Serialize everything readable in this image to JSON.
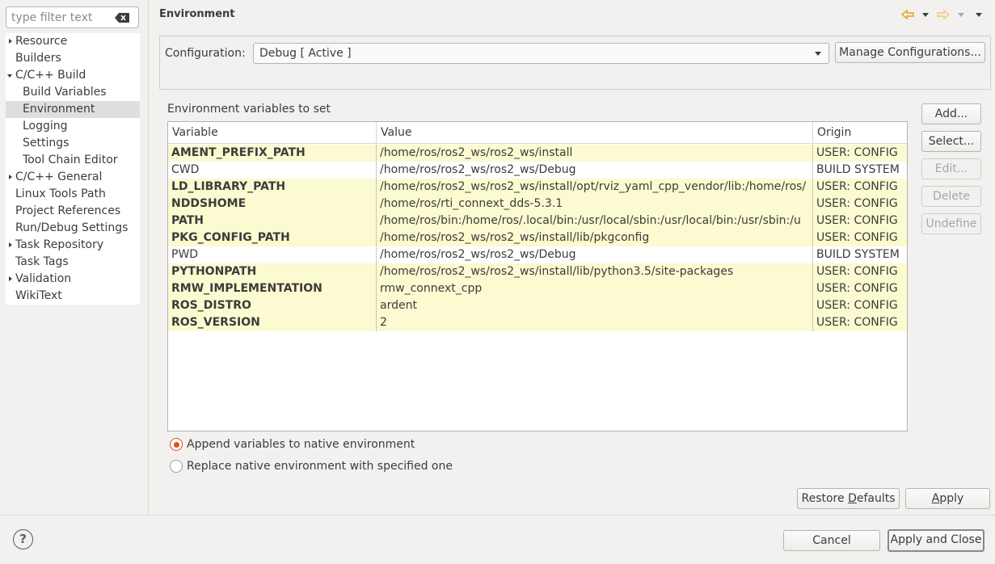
{
  "filter": {
    "placeholder": "type filter text"
  },
  "tree": [
    {
      "label": "Resource",
      "expander": "right",
      "indent": 0
    },
    {
      "label": "Builders",
      "expander": "none",
      "indent": 0
    },
    {
      "label": "C/C++ Build",
      "expander": "down",
      "indent": 0
    },
    {
      "label": "Build Variables",
      "expander": "none",
      "indent": 1
    },
    {
      "label": "Environment",
      "expander": "none",
      "indent": 1,
      "selected": true
    },
    {
      "label": "Logging",
      "expander": "none",
      "indent": 1
    },
    {
      "label": "Settings",
      "expander": "none",
      "indent": 1
    },
    {
      "label": "Tool Chain Editor",
      "expander": "none",
      "indent": 1
    },
    {
      "label": "C/C++ General",
      "expander": "right",
      "indent": 0
    },
    {
      "label": "Linux Tools Path",
      "expander": "none",
      "indent": 0
    },
    {
      "label": "Project References",
      "expander": "none",
      "indent": 0
    },
    {
      "label": "Run/Debug Settings",
      "expander": "none",
      "indent": 0
    },
    {
      "label": "Task Repository",
      "expander": "right",
      "indent": 0
    },
    {
      "label": "Task Tags",
      "expander": "none",
      "indent": 0
    },
    {
      "label": "Validation",
      "expander": "right",
      "indent": 0
    },
    {
      "label": "WikiText",
      "expander": "none",
      "indent": 0
    }
  ],
  "page": {
    "title": "Environment"
  },
  "config": {
    "label": "Configuration:",
    "value": "Debug  [ Active ]",
    "manage_label": "Manage Configurations..."
  },
  "env": {
    "label": "Environment variables to set",
    "columns": [
      "Variable",
      "Value",
      "Origin"
    ],
    "rows": [
      {
        "variable": "AMENT_PREFIX_PATH",
        "value": "/home/ros/ros2_ws/ros2_ws/install",
        "origin": "USER: CONFIG"
      },
      {
        "variable": "CWD",
        "value": "/home/ros/ros2_ws/ros2_ws/Debug",
        "origin": "BUILD SYSTEM"
      },
      {
        "variable": "LD_LIBRARY_PATH",
        "value": "/home/ros/ros2_ws/ros2_ws/install/opt/rviz_yaml_cpp_vendor/lib:/home/ros/",
        "origin": "USER: CONFIG"
      },
      {
        "variable": "NDDSHOME",
        "value": "/home/ros/rti_connext_dds-5.3.1",
        "origin": "USER: CONFIG"
      },
      {
        "variable": "PATH",
        "value": "/home/ros/bin:/home/ros/.local/bin:/usr/local/sbin:/usr/local/bin:/usr/sbin:/u",
        "origin": "USER: CONFIG"
      },
      {
        "variable": "PKG_CONFIG_PATH",
        "value": "/home/ros/ros2_ws/ros2_ws/install/lib/pkgconfig",
        "origin": "USER: CONFIG"
      },
      {
        "variable": "PWD",
        "value": "/home/ros/ros2_ws/ros2_ws/Debug",
        "origin": "BUILD SYSTEM"
      },
      {
        "variable": "PYTHONPATH",
        "value": "/home/ros/ros2_ws/ros2_ws/install/lib/python3.5/site-packages",
        "origin": "USER: CONFIG"
      },
      {
        "variable": "RMW_IMPLEMENTATION",
        "value": "rmw_connext_cpp",
        "origin": "USER: CONFIG"
      },
      {
        "variable": "ROS_DISTRO",
        "value": "ardent",
        "origin": "USER: CONFIG"
      },
      {
        "variable": "ROS_VERSION",
        "value": "2",
        "origin": "USER: CONFIG"
      }
    ]
  },
  "side_buttons": {
    "add": "Add...",
    "select": "Select...",
    "edit": "Edit...",
    "delete": "Delete",
    "undefine": "Undefine"
  },
  "radios": {
    "append": "Append variables to native environment",
    "replace": "Replace native environment with specified one",
    "selected": "append"
  },
  "actions": {
    "restore_pre": "Restore ",
    "restore_mn": "D",
    "restore_post": "efaults",
    "apply_mn": "A",
    "apply_post": "pply"
  },
  "footer": {
    "help": "?",
    "cancel": "Cancel",
    "apply_close": "Apply and Close"
  },
  "colors": {
    "user_row": "#fbfad0",
    "accent": "#d9531e",
    "nav_arrow": "#e5a00d"
  }
}
